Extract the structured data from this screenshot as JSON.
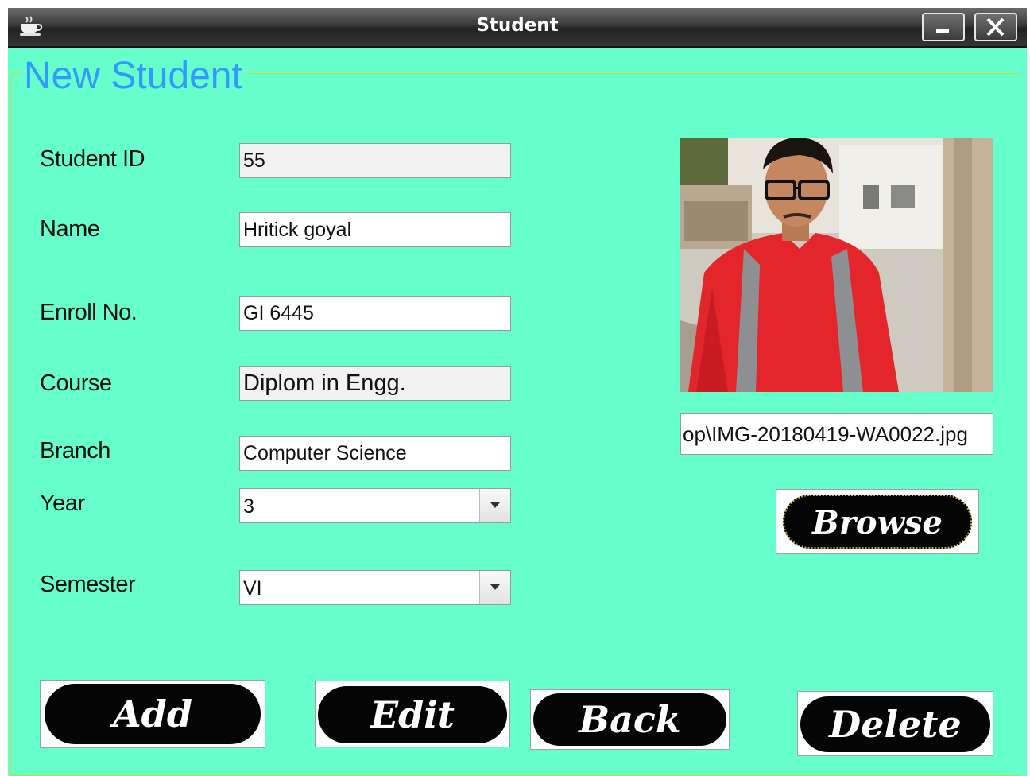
{
  "window": {
    "title": "Student"
  },
  "panel": {
    "title": "New Student"
  },
  "form": {
    "student_id": {
      "label": "Student ID",
      "value": "55"
    },
    "name": {
      "label": "Name",
      "value": "Hritick goyal"
    },
    "enroll_no": {
      "label": "Enroll No.",
      "value": "GI 6445"
    },
    "course": {
      "label": "Course",
      "value": "Diplom in Engg."
    },
    "branch": {
      "label": "Branch",
      "value": "Computer Science"
    },
    "year": {
      "label": "Year",
      "value": "3"
    },
    "semester": {
      "label": "Semester",
      "value": "VI"
    }
  },
  "photo": {
    "path": "op\\IMG-20180419-WA0022.jpg"
  },
  "buttons": {
    "browse": "Browse",
    "add": "Add",
    "edit": "Edit",
    "back": "Back",
    "delete": "Delete"
  },
  "colors": {
    "background": "#66ffcc",
    "legend": "#3399ff",
    "button_fill": "#050505",
    "frame_border": "#d4d43a"
  },
  "icons": {
    "window": "java-coffee-icon",
    "minimize": "minimize-icon",
    "close": "close-icon",
    "dropdown": "chevron-down-icon"
  }
}
